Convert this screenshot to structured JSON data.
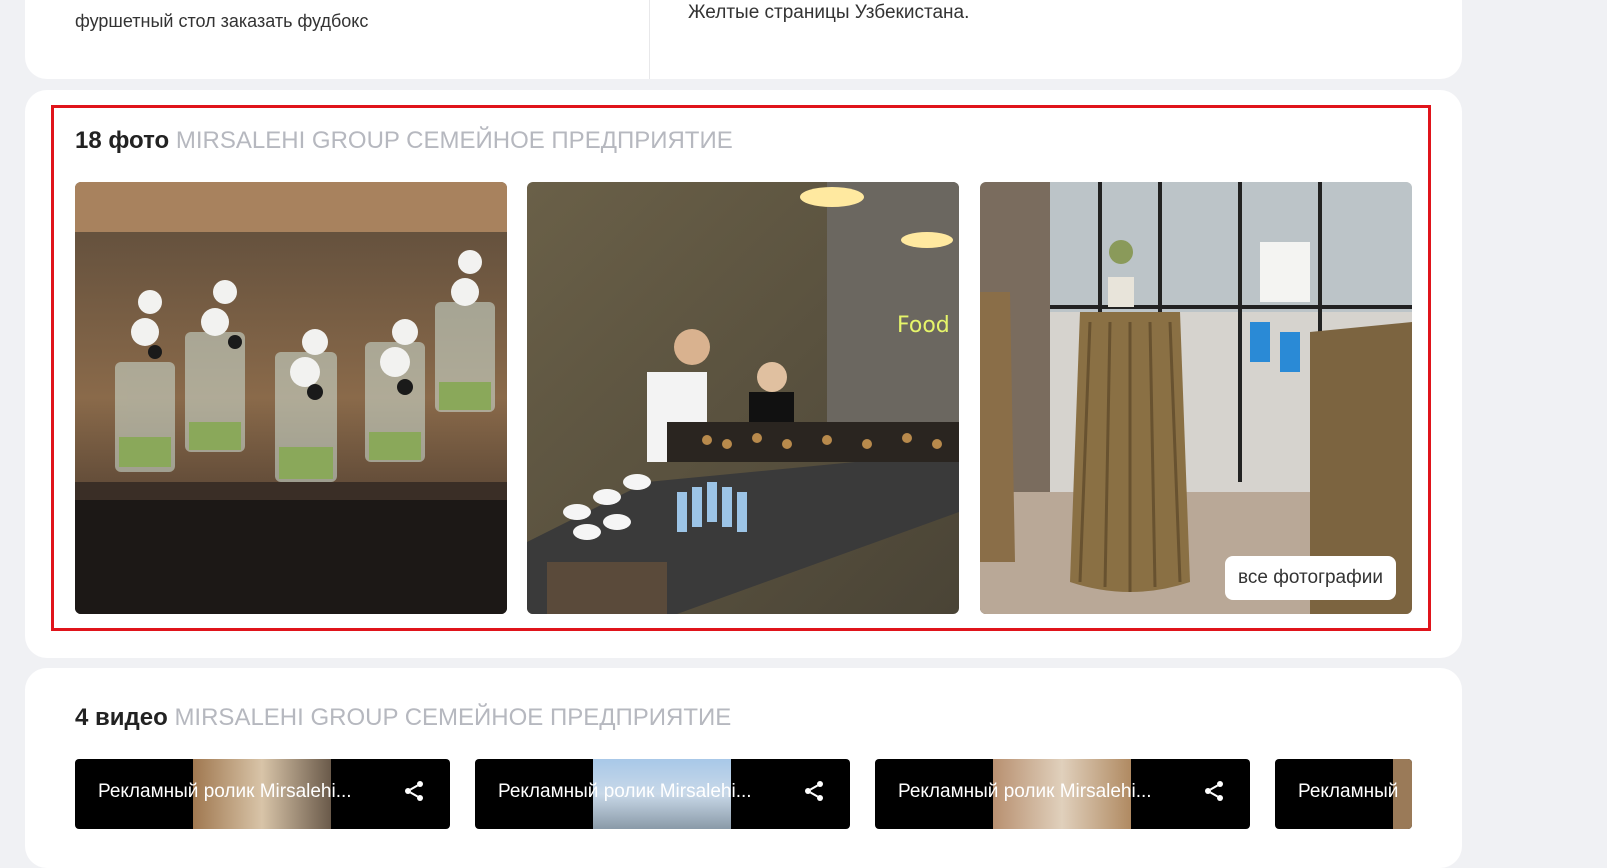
{
  "top_section": {
    "left_text": "фуршетный стол заказать фудбокс",
    "right_text": "Желтые страницы Узбекистана."
  },
  "photos": {
    "count_label": "18 фото",
    "company_name": "MIRSALEHI GROUP СЕМЕЙНОЕ ПРЕДПРИЯТИЕ",
    "all_photos_label": "все фотографии",
    "highlight_color": "#e0141b"
  },
  "videos": {
    "count_label": "4 видео",
    "company_name": "MIRSALEHI GROUP СЕМЕЙНОЕ ПРЕДПРИЯТИЕ",
    "items": [
      {
        "title": "Рекламный ролик Mirsalehi..."
      },
      {
        "title": "Рекламный ролик Mirsalehi..."
      },
      {
        "title": "Рекламный ролик Mirsalehi..."
      },
      {
        "title": "Рекламный"
      }
    ]
  }
}
